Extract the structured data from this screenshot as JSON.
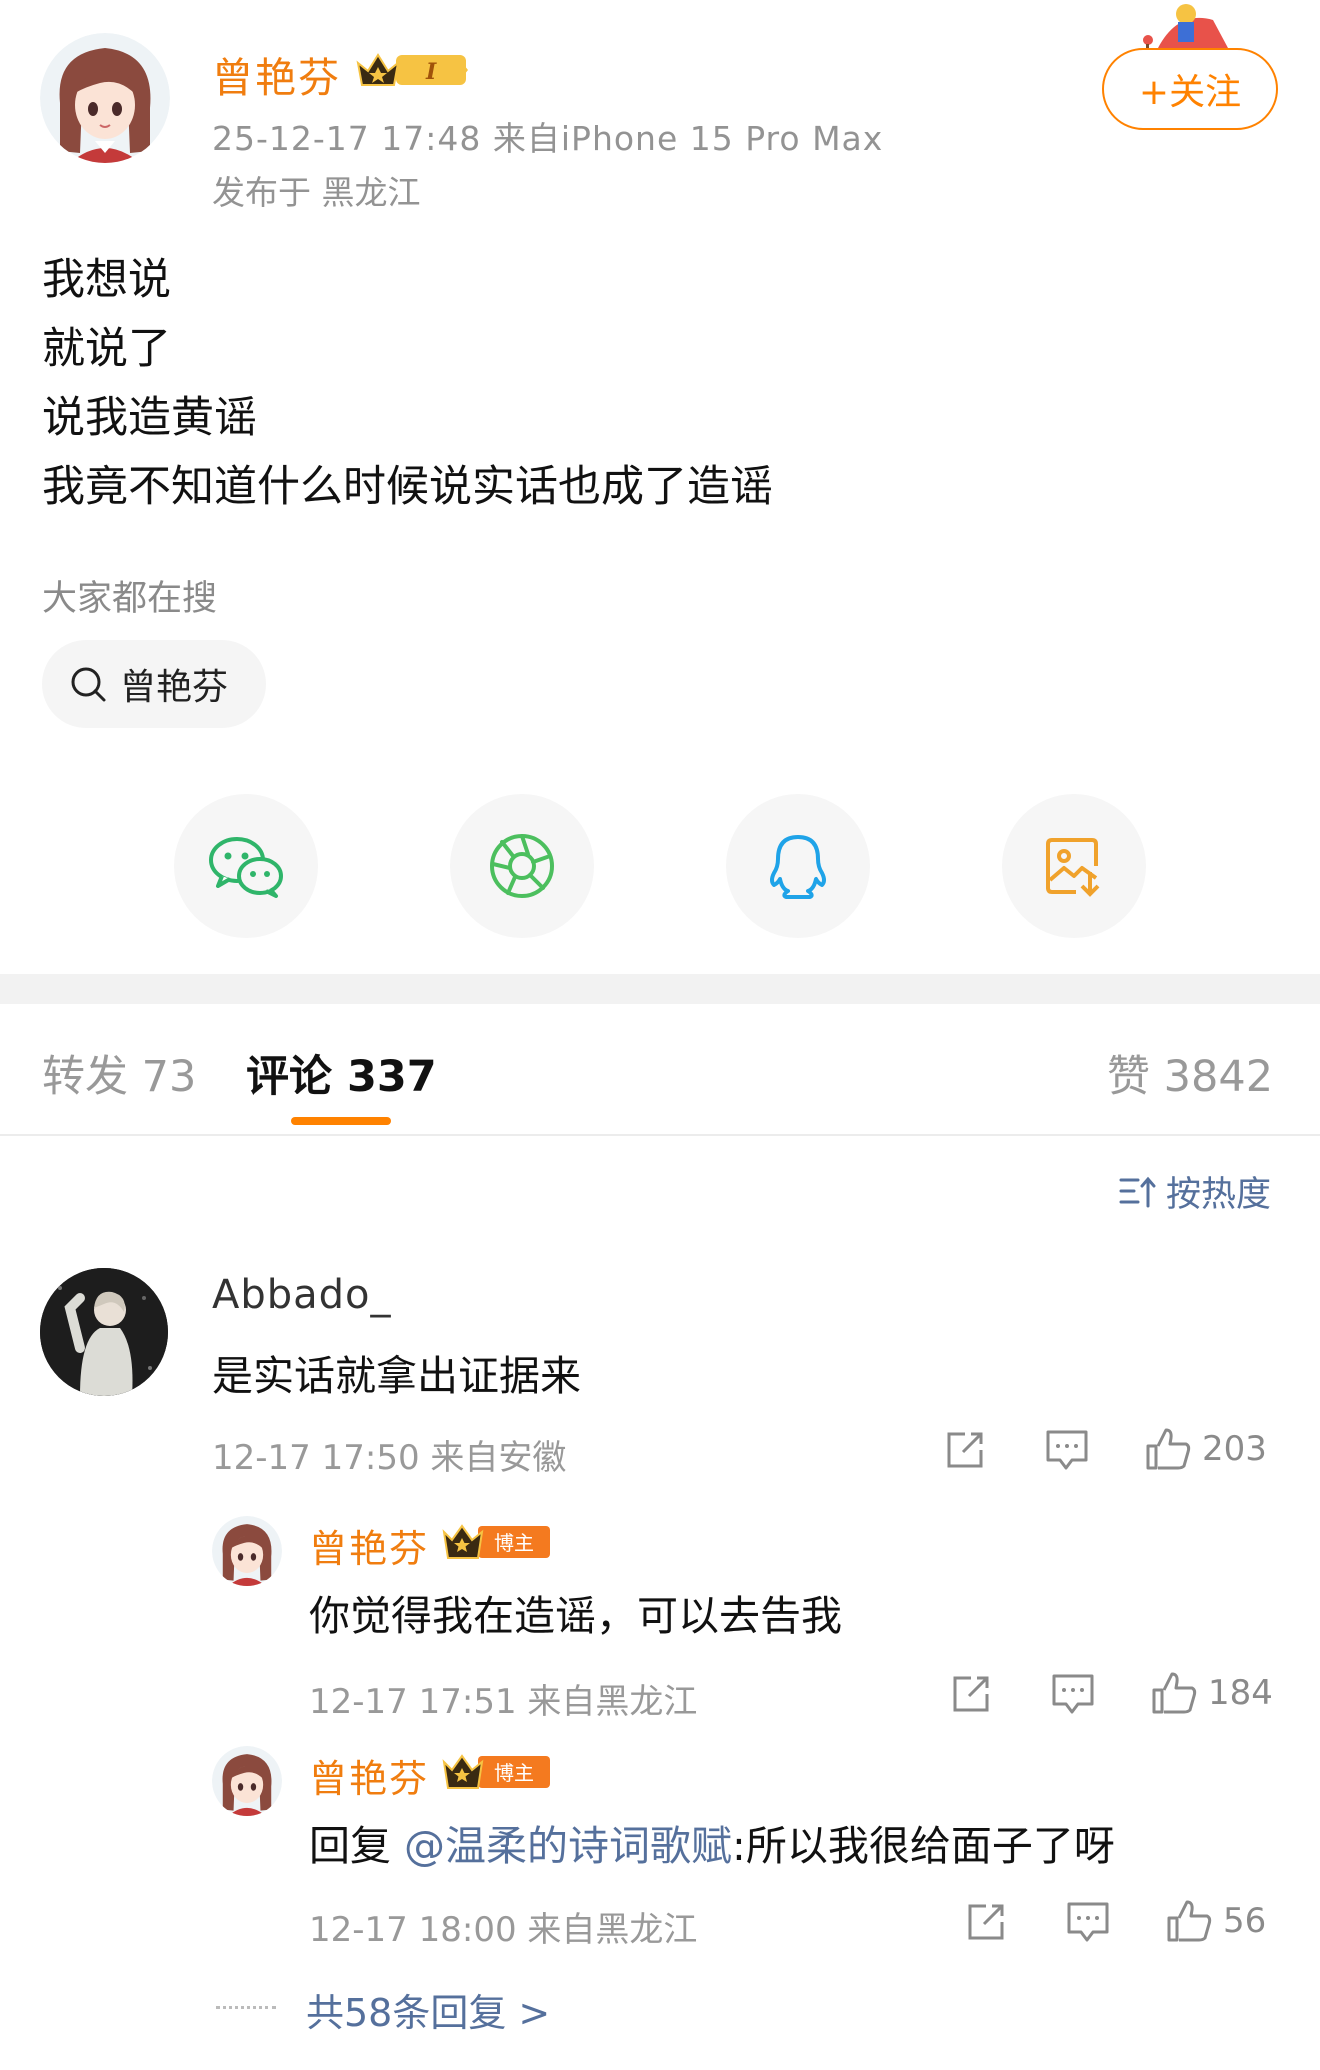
{
  "post": {
    "author": "曾艳芬",
    "meta": "25-12-17 17:48  来自iPhone 15 Pro Max",
    "location": "发布于 黑龙江",
    "follow_label": "+关注",
    "lines": [
      "我想说",
      "就说了",
      "说我造黄谣",
      "我竟不知道什么时候说实话也成了造谣"
    ]
  },
  "search": {
    "hint": "大家都在搜",
    "term": "曾艳芬"
  },
  "share": {
    "icons": [
      "wechat-icon",
      "moments-icon",
      "qq-icon",
      "save-image-icon"
    ]
  },
  "tabs": {
    "repost": "转发 73",
    "comment": "评论 337",
    "likes": "赞 3842"
  },
  "sort_label": "按热度",
  "comments": [
    {
      "user": "Abbado_",
      "text": "是实话就拿出证据来",
      "meta": "12-17 17:50  来自安徽",
      "likes": "203"
    }
  ],
  "replies": [
    {
      "user": "曾艳芬",
      "badge": "博主",
      "text": "你觉得我在造谣，可以去告我",
      "meta": "12-17 17:51  来自黑龙江",
      "likes": "184"
    },
    {
      "user": "曾艳芬",
      "badge": "博主",
      "reply_prefix": "回复",
      "mention": "@温柔的诗词歌赋",
      "text": ":所以我很给面子了呀",
      "meta": "12-17 18:00  来自黑龙江",
      "likes": "56"
    }
  ],
  "more_replies": "共58条回复 >",
  "colors": {
    "accent_orange": "#ff8200",
    "name_orange": "#f07d0f",
    "link_blue": "#55709c"
  }
}
